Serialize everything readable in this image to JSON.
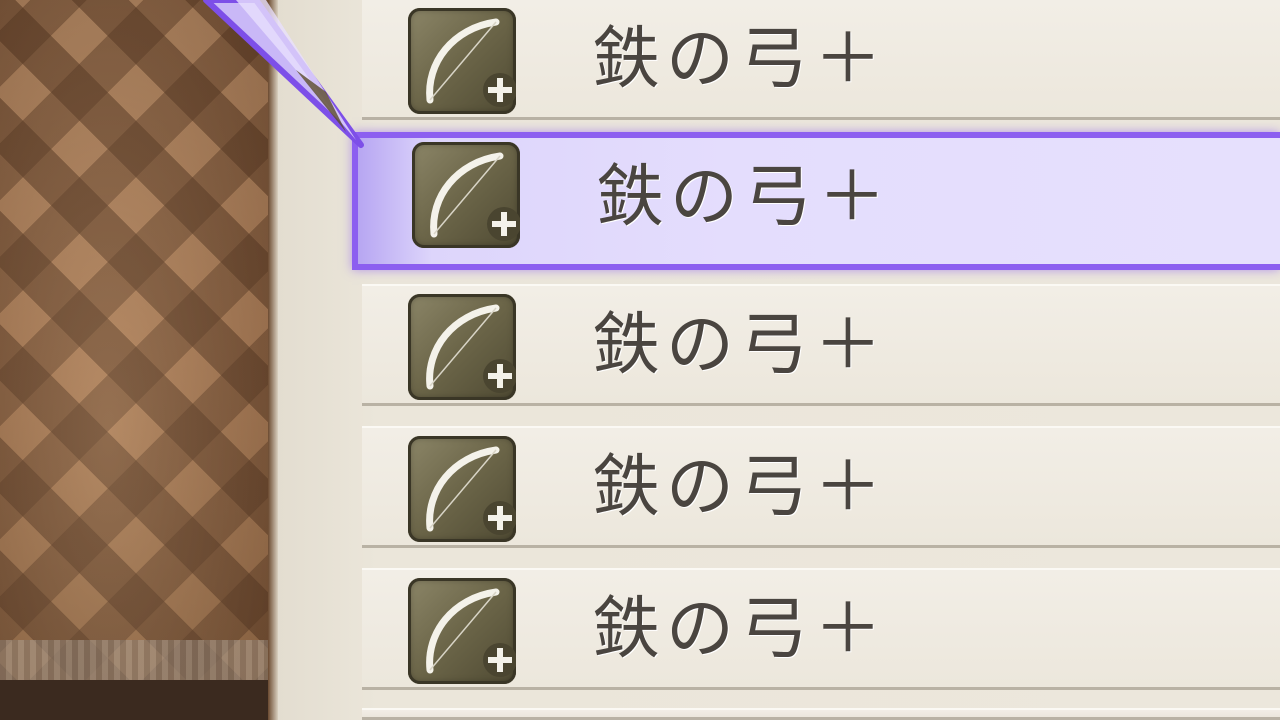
{
  "items": [
    {
      "name": "鉄の弓＋",
      "icon": "bow-plus-icon",
      "selected": false
    },
    {
      "name": "鉄の弓＋",
      "icon": "bow-plus-icon",
      "selected": true
    },
    {
      "name": "鉄の弓＋",
      "icon": "bow-plus-icon",
      "selected": false
    },
    {
      "name": "鉄の弓＋",
      "icon": "bow-plus-icon",
      "selected": false
    },
    {
      "name": "鉄の弓＋",
      "icon": "bow-plus-icon",
      "selected": false
    }
  ],
  "colors": {
    "selection_border": "#8c5ff0",
    "selection_fill": "#e4ddfd",
    "row_fill": "#ece7dc",
    "text": "#4a4540"
  }
}
